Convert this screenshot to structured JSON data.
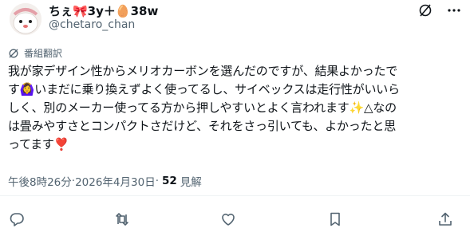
{
  "header": {
    "display_name": "ちぇ🎀3y＋🥚38w",
    "handle": "@chetaro_chan"
  },
  "translate": {
    "label": "番組翻訳"
  },
  "tweet": {
    "lines": [
      "我が家デザイン性からメリオカーボンを選んだのですが、結果よかったで",
      "す🙆‍♀️いまだに乗り換えずよく使ってるし、サイベックスは走行性がいいら",
      "しく、別のメーカー使ってる方から押しやすいとよく言われます✨△なの",
      "は畳みやすさとコンパクトさだけど、それをさっ引いても、よかったと思",
      "ってます❣️"
    ]
  },
  "meta": {
    "time": "午後8時26分",
    "sep1": " · ",
    "date": "2026年4月30日",
    "sep2": " · ",
    "views_count": "52",
    "views_label": "見解"
  },
  "icons": {
    "top": [
      "grok-slash-icon",
      "more-icon"
    ],
    "actions": [
      "reply-icon",
      "retweet-icon",
      "like-icon",
      "bookmark-icon",
      "share-icon"
    ]
  },
  "colors": {
    "text": "#0f1419",
    "secondary": "#536471",
    "divider": "#eff3f4"
  }
}
